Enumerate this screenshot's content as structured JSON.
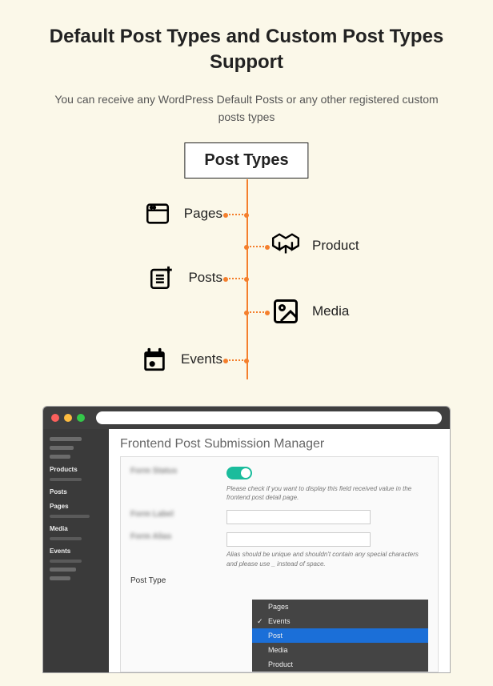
{
  "heading": "Default Post Types and Custom Post Types Support",
  "subheading": "You can receive any WordPress Default Posts or any other registered custom posts types",
  "diagram": {
    "root": "Post Types",
    "pages": "Pages",
    "posts": "Posts",
    "events": "Events",
    "product": "Product",
    "media": "Media"
  },
  "screenshot": {
    "sidebar": {
      "products": "Products",
      "posts": "Posts",
      "pages": "Pages",
      "media": "Media",
      "events": "Events"
    },
    "title": "Frontend Post Submission Manager",
    "form": {
      "status_label": "Form Status",
      "status_help": "Please check if you want to display this field received value in the frontend post detail page.",
      "label_label": "Form Label",
      "alias_label": "Form Alias",
      "alias_help": "Alias should be unique and shouldn't contain any special characters and please use _ instead of space.",
      "posttype_label": "Post Type"
    },
    "dropdown": {
      "pages": "Pages",
      "events": "Events",
      "post": "Post",
      "media": "Media",
      "product": "Product"
    }
  }
}
